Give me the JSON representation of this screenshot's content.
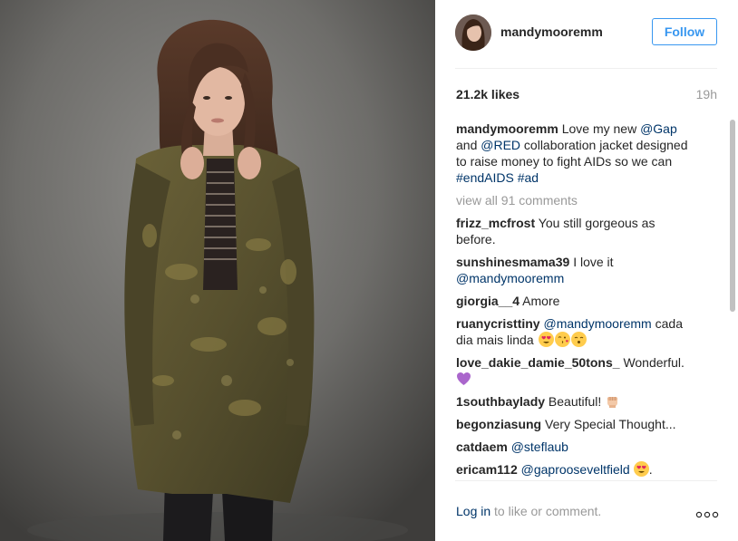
{
  "post": {
    "username": "mandymooremm",
    "follow_label": "Follow",
    "likes": "21.2k likes",
    "time": "19h",
    "caption": {
      "user": "mandymooremm",
      "parts": [
        "Love my new ",
        "@Gap",
        " and ",
        "@RED",
        " collaboration jacket designed to raise money to fight AIDs so we can ",
        "#endAIDS",
        " ",
        "#ad"
      ]
    },
    "view_all": "view all 91 comments",
    "comments": [
      {
        "user": "frizz_mcfrost",
        "text": "You still gorgeous as before."
      },
      {
        "user": "sunshinesmama39",
        "text": "I love it ",
        "mention": "@mandymooremm"
      },
      {
        "user": "giorgia__4",
        "text": "Amore"
      },
      {
        "user": "ruanycristtiny",
        "mention": "@mandymooremm",
        "text": " cada dia mais linda ",
        "emojis": [
          "heart-eyes-emoji",
          "kiss-emoji",
          "kissing-emoji"
        ]
      },
      {
        "user": "love_dakie_damie_50tons_",
        "text": "Wonderful.",
        "emojis": [
          "purple-heart-emoji"
        ]
      },
      {
        "user": "1southbaylady",
        "text": "Beautiful! ",
        "emojis": [
          "raised-fist-emoji"
        ]
      },
      {
        "user": "begonziasung",
        "text": "Very Special Thought..."
      },
      {
        "user": "catdaem",
        "mention": "@steflaub"
      },
      {
        "user": "ericam112",
        "mention": "@gaprooseveltfield",
        "text": ".",
        "emojis": [
          "heart-eyes-emoji"
        ]
      }
    ],
    "login_link": "Log in",
    "login_rest": " to like or comment."
  },
  "icons": {
    "more": "more-options-icon"
  },
  "colors": {
    "link_blue": "#003569",
    "follow_blue": "#3897f0",
    "muted": "#999999",
    "text": "#262626"
  }
}
